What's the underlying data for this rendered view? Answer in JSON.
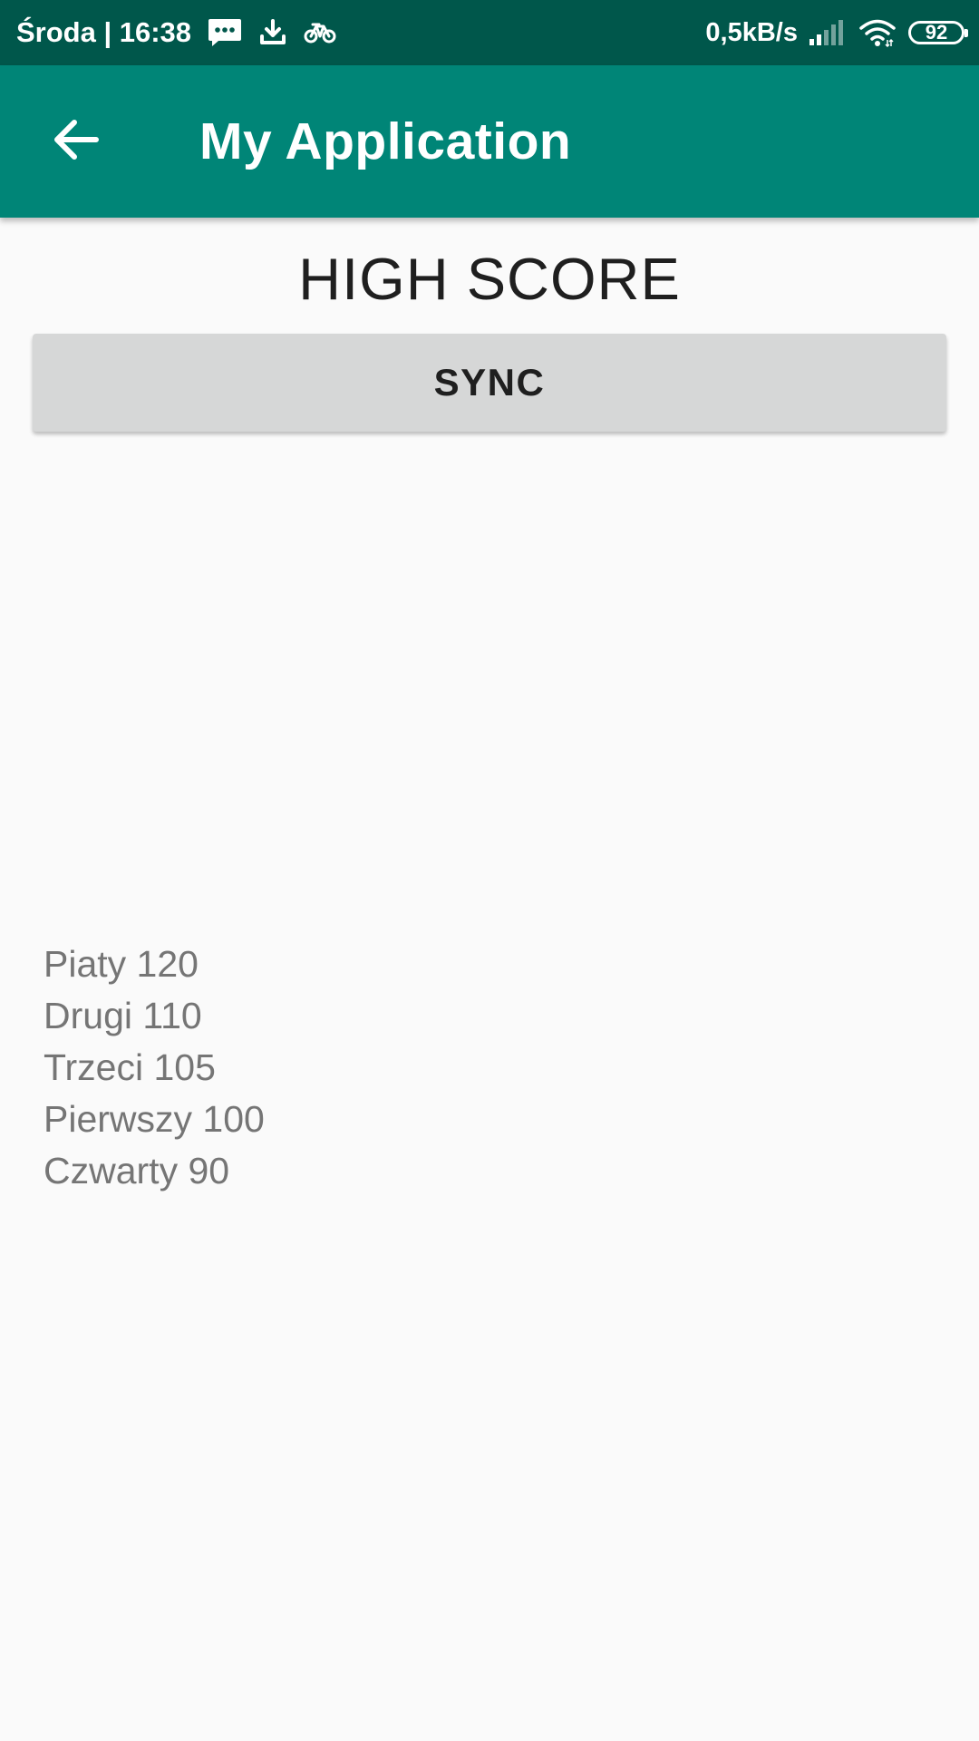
{
  "status_bar": {
    "day_time": "Środa | 16:38",
    "speed": "0,5kB/s",
    "battery": "92",
    "icons": [
      "message-icon",
      "download-icon",
      "bike-icon",
      "signal-icon",
      "wifi-icon",
      "battery-icon"
    ]
  },
  "app_bar": {
    "title": "My Application",
    "back_icon": "arrow-left-icon"
  },
  "main": {
    "heading": "HIGH SCORE",
    "sync_label": "SYNC",
    "scores": [
      {
        "text": "Piaty 120"
      },
      {
        "text": "Drugi 110"
      },
      {
        "text": "Trzeci 105"
      },
      {
        "text": "Pierwszy 100"
      },
      {
        "text": "Czwarty 90"
      }
    ]
  },
  "colors": {
    "status_bar": "#00574b",
    "app_bar": "#008577",
    "background": "#fafafa",
    "button": "#d6d7d7",
    "score_text": "#757575"
  }
}
